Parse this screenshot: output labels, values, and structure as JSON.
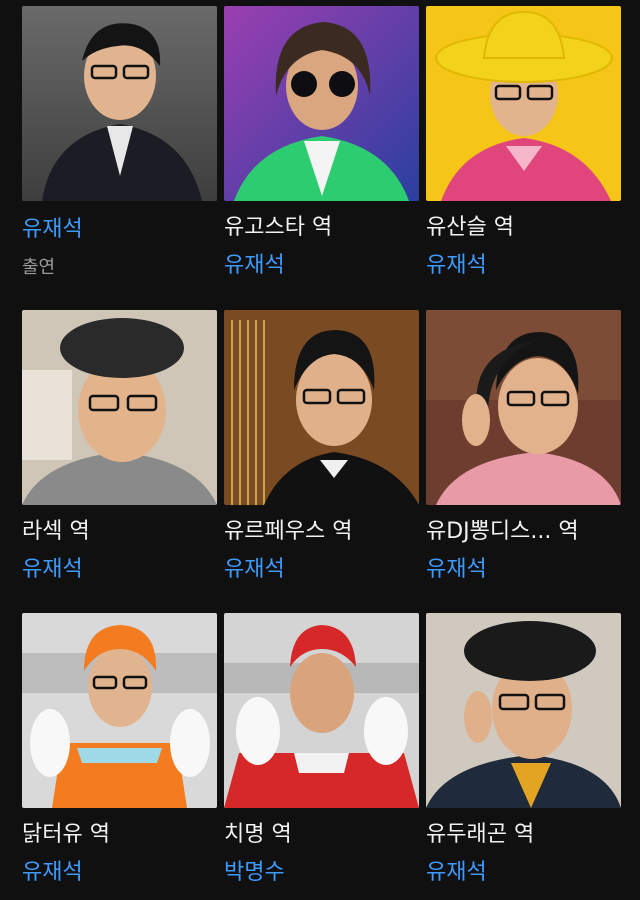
{
  "cast": [
    {
      "role": "",
      "person": "유재석",
      "note": "출연",
      "bg": "#5a5a5a",
      "accent": "#1c1c24"
    },
    {
      "role": "유고스타 역",
      "person": "유재석",
      "note": "",
      "bg": "#6b3fa0",
      "accent": "#2ecc71"
    },
    {
      "role": "유산슬 역",
      "person": "유재석",
      "note": "",
      "bg": "#f5c518",
      "accent": "#e0457b"
    },
    {
      "role": "라섹 역",
      "person": "유재석",
      "note": "",
      "bg": "#cfc6b8",
      "accent": "#2a2a2a"
    },
    {
      "role": "유르페우스 역",
      "person": "유재석",
      "note": "",
      "bg": "#8a5a2b",
      "accent": "#111111"
    },
    {
      "role": "유DJ뽕디스... 역",
      "person": "유재석",
      "note": "",
      "bg": "#7a4a3a",
      "accent": "#e89aa6"
    },
    {
      "role": "닭터유 역",
      "person": "유재석",
      "note": "",
      "bg": "#d9d9d9",
      "accent": "#f47c20"
    },
    {
      "role": "치명 역",
      "person": "박명수",
      "note": "",
      "bg": "#d4d4d4",
      "accent": "#d62828"
    },
    {
      "role": "유두래곤 역",
      "person": "유재석",
      "note": "",
      "bg": "#cfc9c0",
      "accent": "#1f2a3a"
    }
  ]
}
